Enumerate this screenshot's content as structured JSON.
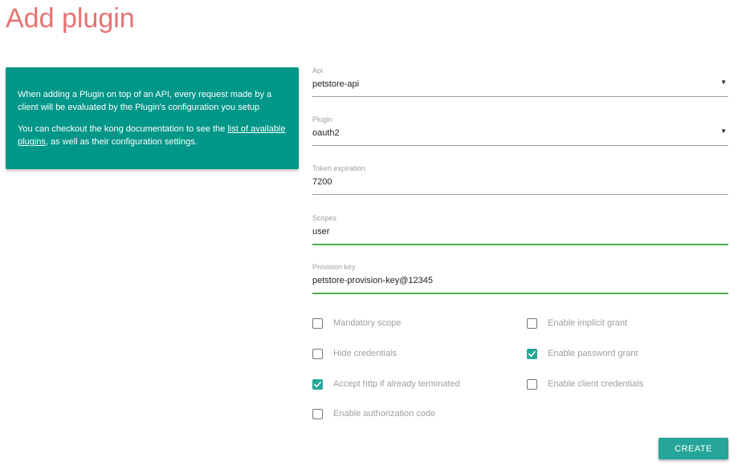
{
  "colors": {
    "title": "#e57373",
    "accent": "#009688",
    "button": "#26a69a",
    "active_line": "#4caf50"
  },
  "page": {
    "title": "Add plugin"
  },
  "info": {
    "p1": "When adding a Plugin on top of an API, every request made by a client will be evaluated by the Plugin's configuration you setup",
    "p2_prefix": "You can checkout the kong documentation to see the ",
    "p2_link": "list of available plugins",
    "p2_suffix": ", as well as their configuration settings."
  },
  "form": {
    "api": {
      "label": "Api",
      "value": "petstore-api"
    },
    "plugin": {
      "label": "Plugin",
      "value": "oauth2"
    },
    "token_expiration": {
      "label": "Token expiration",
      "value": "7200"
    },
    "scopes": {
      "label": "Scopes",
      "value": "user"
    },
    "provision_key": {
      "label": "Provision key",
      "value": "petstore-provision-key@12345"
    }
  },
  "checkboxes": {
    "mandatory_scope": {
      "label": "Mandatory scope",
      "checked": false
    },
    "hide_credentials": {
      "label": "Hide credentials",
      "checked": false
    },
    "accept_http": {
      "label": "Accept http if already terminated",
      "checked": true
    },
    "enable_authorization_code": {
      "label": "Enable authorization code",
      "checked": false
    },
    "enable_implicit_grant": {
      "label": "Enable implicit grant",
      "checked": false
    },
    "enable_password_grant": {
      "label": "Enable password grant",
      "checked": true
    },
    "enable_client_credentials": {
      "label": "Enable client credentials",
      "checked": false
    }
  },
  "actions": {
    "create_label": "CREATE"
  }
}
